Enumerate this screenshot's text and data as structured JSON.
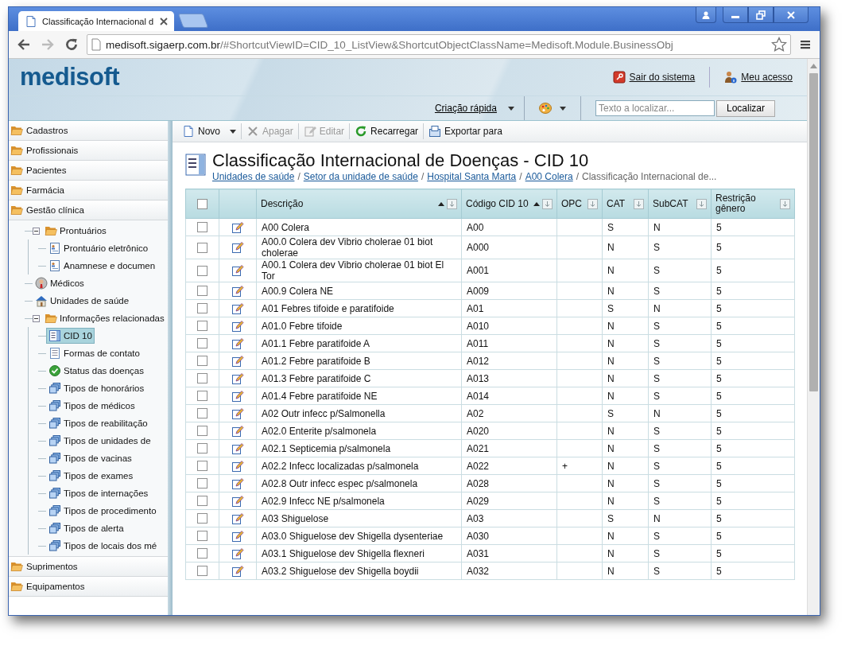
{
  "browser": {
    "tab_title": "Classificação Internacional d",
    "url_host": "medisoft.sigaerp.com.br",
    "url_path": "/#ShortcutViewID=CID_10_ListView&ShortcutObjectClassName=Medisoft.Module.BusinessObj"
  },
  "header": {
    "logo": "medisoft",
    "links": [
      {
        "label": "Sair do sistema",
        "kind": "exit"
      },
      {
        "label": "Meu acesso",
        "kind": "user"
      }
    ],
    "quick_create": "Criação rápida",
    "search": {
      "placeholder": "Texto a localizar..."
    },
    "search_button": "Localizar"
  },
  "sidebar": {
    "groups": [
      {
        "label": "Cadastros"
      },
      {
        "label": "Profissionais"
      },
      {
        "label": "Pacientes"
      },
      {
        "label": "Farmácia"
      },
      {
        "label": "Gestão clínica",
        "children": [
          {
            "label": "Prontuários",
            "kind": "folder",
            "selected": false,
            "expanded": true,
            "children": [
              {
                "label": "Prontuário eletrônico",
                "kind": "record",
                "selected": false
              },
              {
                "label": "Anamnese e documen",
                "kind": "record",
                "selected": false
              }
            ]
          },
          {
            "label": "Médicos",
            "kind": "person",
            "selected": false
          },
          {
            "label": "Unidades de saúde",
            "kind": "house",
            "selected": false
          },
          {
            "label": "Informações relacionadas",
            "kind": "folder",
            "selected": false,
            "expanded": true,
            "children": [
              {
                "label": "CID 10",
                "kind": "form",
                "selected": true
              },
              {
                "label": "Formas de contato",
                "kind": "page",
                "selected": false
              },
              {
                "label": "Status das doenças",
                "kind": "status",
                "selected": false
              },
              {
                "label": "Tipos de honorários",
                "kind": "stack",
                "selected": false
              },
              {
                "label": "Tipos de médicos",
                "kind": "stack",
                "selected": false
              },
              {
                "label": "Tipos de reabilitação",
                "kind": "stack",
                "selected": false
              },
              {
                "label": "Tipos de unidades de",
                "kind": "stack",
                "selected": false
              },
              {
                "label": "Tipos de vacinas",
                "kind": "stack",
                "selected": false
              },
              {
                "label": "Tipos de exames",
                "kind": "stack",
                "selected": false
              },
              {
                "label": "Tipos de internações",
                "kind": "stack",
                "selected": false
              },
              {
                "label": "Tipos de procedimento",
                "kind": "stack",
                "selected": false
              },
              {
                "label": "Tipos de alerta",
                "kind": "stack",
                "selected": false
              },
              {
                "label": "Tipos de locais dos mé",
                "kind": "stack",
                "selected": false
              }
            ]
          }
        ]
      },
      {
        "label": "Suprimentos"
      },
      {
        "label": "Equipamentos"
      }
    ]
  },
  "toolbar": [
    {
      "label": "Novo",
      "kind": "new",
      "disabled": false,
      "dropdown": true
    },
    {
      "label": "Apagar",
      "kind": "delete",
      "disabled": true,
      "dropdown": false
    },
    {
      "label": "Editar",
      "kind": "edit",
      "disabled": true,
      "dropdown": false
    },
    {
      "label": "Recarregar",
      "kind": "reload",
      "disabled": false,
      "dropdown": false
    },
    {
      "label": "Exportar para",
      "kind": "export",
      "disabled": false,
      "dropdown": false
    }
  ],
  "title": "Classificação Internacional de Doenças - CID 10",
  "breadcrumb": {
    "separator": "/",
    "items": [
      {
        "label": "Unidades de saúde",
        "link": true
      },
      {
        "label": "Setor da unidade de saúde",
        "link": true
      },
      {
        "label": "Hospital Santa Marta",
        "link": true
      },
      {
        "label": "A00 Colera",
        "link": true
      },
      {
        "label": "Classificação Internacional de...",
        "link": false
      }
    ]
  },
  "table": {
    "all_checked": false,
    "columns": [
      {
        "label": "Descrição",
        "sorted_ascending": true
      },
      {
        "label": "Código CID 10",
        "sorted_ascending": true
      },
      {
        "label": "OPC",
        "sorted_ascending": false
      },
      {
        "label": "CAT",
        "sorted_ascending": false
      },
      {
        "label": "SubCAT",
        "sorted_ascending": false
      },
      {
        "label": "Restrição gênero",
        "sorted_ascending": false
      }
    ],
    "rows": [
      {
        "checked": false,
        "description": "A00 Colera",
        "code": "A00",
        "cat": "S",
        "subcat": "N",
        "restriction": "5"
      },
      {
        "checked": false,
        "description": "A00.0 Colera dev Vibrio cholerae 01 biot cholerae",
        "code": "A000",
        "cat": "N",
        "subcat": "S",
        "restriction": "5"
      },
      {
        "checked": false,
        "description": "A00.1 Colera dev Vibrio cholerae 01 biot El Tor",
        "code": "A001",
        "cat": "N",
        "subcat": "S",
        "restriction": "5"
      },
      {
        "checked": false,
        "description": "A00.9 Colera NE",
        "code": "A009",
        "cat": "N",
        "subcat": "S",
        "restriction": "5"
      },
      {
        "checked": false,
        "description": "A01 Febres tifoide e paratifoide",
        "code": "A01",
        "cat": "S",
        "subcat": "N",
        "restriction": "5"
      },
      {
        "checked": false,
        "description": "A01.0 Febre tifoide",
        "code": "A010",
        "cat": "N",
        "subcat": "S",
        "restriction": "5"
      },
      {
        "checked": false,
        "description": "A01.1 Febre paratifoide A",
        "code": "A011",
        "cat": "N",
        "subcat": "S",
        "restriction": "5"
      },
      {
        "checked": false,
        "description": "A01.2 Febre paratifoide B",
        "code": "A012",
        "cat": "N",
        "subcat": "S",
        "restriction": "5"
      },
      {
        "checked": false,
        "description": "A01.3 Febre paratifoide C",
        "code": "A013",
        "cat": "N",
        "subcat": "S",
        "restriction": "5"
      },
      {
        "checked": false,
        "description": "A01.4 Febre paratifoide NE",
        "code": "A014",
        "cat": "N",
        "subcat": "S",
        "restriction": "5"
      },
      {
        "checked": false,
        "description": "A02 Outr infecc p/Salmonella",
        "code": "A02",
        "cat": "S",
        "subcat": "N",
        "restriction": "5"
      },
      {
        "checked": false,
        "description": "A02.0 Enterite p/salmonela",
        "code": "A020",
        "cat": "N",
        "subcat": "S",
        "restriction": "5"
      },
      {
        "checked": false,
        "description": "A02.1 Septicemia p/salmonela",
        "code": "A021",
        "cat": "N",
        "subcat": "S",
        "restriction": "5"
      },
      {
        "checked": false,
        "description": "A02.2 Infecc localizadas p/salmonela",
        "code": "A022",
        "opc": "+",
        "cat": "N",
        "subcat": "S",
        "restriction": "5"
      },
      {
        "checked": false,
        "description": "A02.8 Outr infecc espec p/salmonela",
        "code": "A028",
        "cat": "N",
        "subcat": "S",
        "restriction": "5"
      },
      {
        "checked": false,
        "description": "A02.9 Infecc NE p/salmonela",
        "code": "A029",
        "cat": "N",
        "subcat": "S",
        "restriction": "5"
      },
      {
        "checked": false,
        "description": "A03 Shiguelose",
        "code": "A03",
        "cat": "S",
        "subcat": "N",
        "restriction": "5"
      },
      {
        "checked": false,
        "description": "A03.0 Shiguelose dev Shigella dysenteriae",
        "code": "A030",
        "cat": "N",
        "subcat": "S",
        "restriction": "5"
      },
      {
        "checked": false,
        "description": "A03.1 Shiguelose dev Shigella flexneri",
        "code": "A031",
        "cat": "N",
        "subcat": "S",
        "restriction": "5"
      },
      {
        "checked": false,
        "description": "A03.2 Shiguelose dev Shigella boydii",
        "code": "A032",
        "cat": "N",
        "subcat": "S",
        "restriction": "5"
      }
    ]
  }
}
